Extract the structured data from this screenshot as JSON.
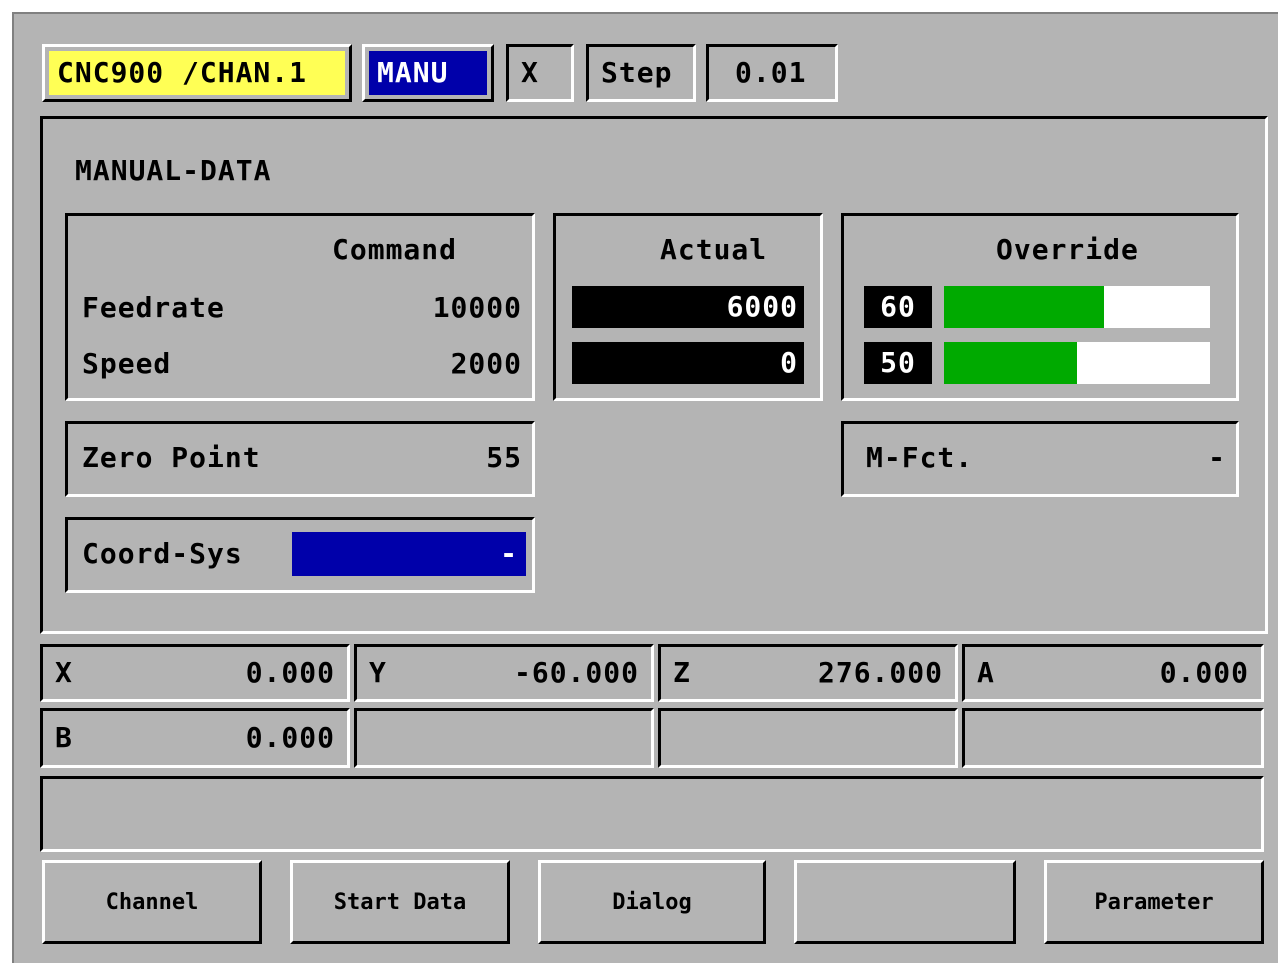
{
  "header": {
    "channel": "CNC900 /CHAN.1",
    "mode": "MANU",
    "axis": "X",
    "step_label": "Step",
    "step_value": "0.01"
  },
  "panel": {
    "title": "MANUAL-DATA"
  },
  "command": {
    "heading": "Command",
    "feedrate_label": "Feedrate",
    "feedrate_value": "10000",
    "speed_label": "Speed",
    "speed_value": "2000"
  },
  "actual": {
    "heading": "Actual",
    "feedrate_value": "6000",
    "speed_value": "0"
  },
  "override": {
    "heading": "Override",
    "feed_value": "60",
    "speed_value": "50",
    "feed_percent": 60,
    "speed_percent": 50
  },
  "zero_point": {
    "label": "Zero Point",
    "value": "55"
  },
  "m_function": {
    "label": "M-Fct.",
    "value": "-"
  },
  "coord_sys": {
    "label": "Coord-Sys",
    "value": "-"
  },
  "axes": [
    {
      "name": "X",
      "value": "0.000"
    },
    {
      "name": "Y",
      "value": "-60.000"
    },
    {
      "name": "Z",
      "value": "276.000"
    },
    {
      "name": "A",
      "value": "0.000"
    },
    {
      "name": "B",
      "value": "0.000"
    }
  ],
  "message_line": "",
  "softkeys": [
    "Channel",
    "Start Data",
    "Dialog",
    "",
    "Parameter"
  ],
  "colors": {
    "background": "#b4b4b4",
    "channel_highlight": "#ffff55",
    "mode_highlight": "#0000aa",
    "coord_sys_highlight": "#0000aa",
    "override_bar": "#00aa00"
  }
}
